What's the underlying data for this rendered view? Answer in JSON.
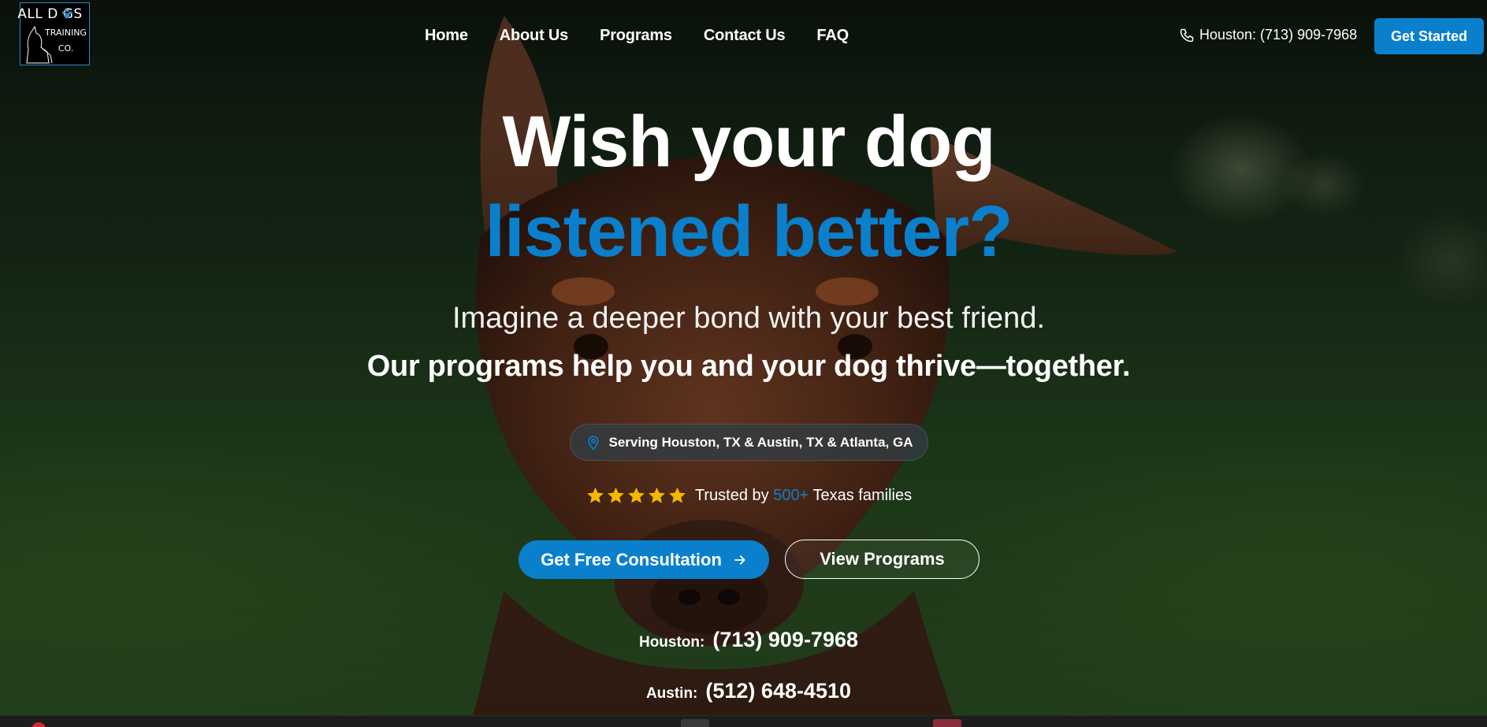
{
  "logo": {
    "line1": "ALL D  GS",
    "line2": "TRAINING",
    "line3": "CO."
  },
  "nav": {
    "items": [
      "Home",
      "About Us",
      "Programs",
      "Contact Us",
      "FAQ"
    ]
  },
  "header": {
    "phone": "Houston: (713) 909-7968",
    "cta": "Get Started"
  },
  "hero": {
    "headline_1": "Wish your dog",
    "headline_2": "listened better?",
    "sub_1": "Imagine a deeper bond with your best friend.",
    "sub_2": "Our programs help you and your dog thrive—together.",
    "location": "Serving Houston, TX & Austin, TX & Atlanta, GA",
    "rating_stars": 5,
    "trust_prefix": "Trusted by",
    "trust_count": "500+",
    "trust_suffix": "Texas families",
    "primary_button": "Get Free Consultation",
    "secondary_button": "View Programs"
  },
  "contacts": [
    {
      "label": "Houston:",
      "phone": "(713) 909-7968"
    },
    {
      "label": "Austin:",
      "phone": "(512) 648-4510"
    }
  ],
  "colors": {
    "accent": "#0a80cc",
    "star": "#f5b800"
  },
  "icons": [
    "phone-icon",
    "location-pin-icon",
    "star-icon",
    "arrow-right-icon",
    "paw-icon"
  ]
}
